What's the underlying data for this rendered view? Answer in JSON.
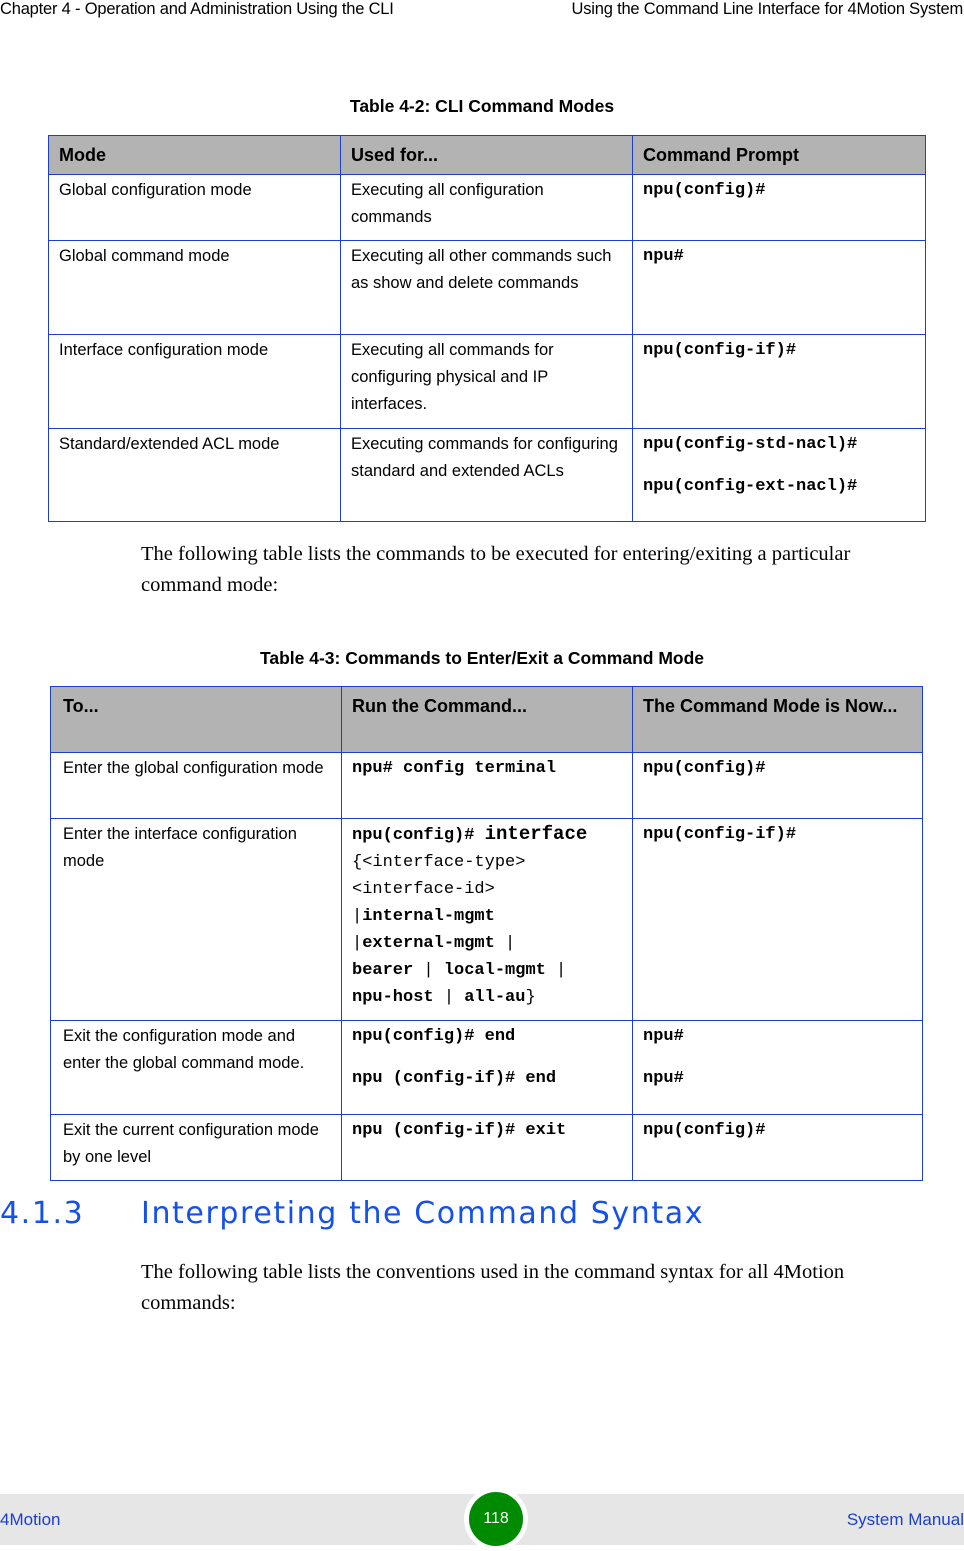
{
  "header": {
    "chapter": "Chapter 4 - Operation and Administration Using the CLI",
    "section": "Using the Command Line Interface for 4Motion System"
  },
  "table_modes": {
    "caption": "Table 4-2: CLI Command Modes",
    "columns": [
      "Mode",
      "Used for...",
      "Command Prompt"
    ],
    "rows": [
      {
        "mode": "Global configuration mode",
        "used_for": "Executing all configuration commands",
        "prompts": [
          "npu(config)#"
        ]
      },
      {
        "mode": "Global command mode",
        "used_for": "Executing all other commands such as show and delete commands",
        "prompts": [
          "npu#"
        ]
      },
      {
        "mode": "Interface configuration mode",
        "used_for": "Executing all commands for configuring physical and IP interfaces.",
        "prompts": [
          "npu(config-if)#"
        ]
      },
      {
        "mode": "Standard/extended ACL mode",
        "used_for": "Executing commands for configuring standard and extended ACLs",
        "prompts": [
          "npu(config-std-nacl)#",
          "npu(config-ext-nacl)#"
        ]
      }
    ]
  },
  "paragraph_1": "The following table lists the commands to be executed for entering/exiting a particular command mode:",
  "table_enter_exit": {
    "caption": "Table 4-3: Commands to Enter/Exit a Command Mode",
    "columns": [
      "To...",
      "Run the Command...",
      "The Command Mode is Now..."
    ],
    "rows": [
      {
        "to": "Enter the global configuration mode",
        "commands": [
          "npu# config terminal"
        ],
        "result_modes": [
          "npu(config)#"
        ]
      },
      {
        "to": "Enter the interface configuration mode",
        "command_lines": [
          "npu(config)# interface",
          "{<interface-type>",
          "<interface-id>",
          "|internal-mgmt",
          "|external-mgmt |",
          "bearer | local-mgmt |",
          "npu-host | all-au}"
        ],
        "result_modes": [
          "npu(config-if)#"
        ]
      },
      {
        "to": "Exit the configuration mode and enter the global command mode.",
        "commands": [
          "npu(config)# end",
          "npu (config-if)# end"
        ],
        "result_modes": [
          "npu#",
          "npu#"
        ]
      },
      {
        "to": "Exit the current configuration mode by one level",
        "commands": [
          "npu (config-if)# exit"
        ],
        "result_modes": [
          "npu(config)#"
        ]
      }
    ]
  },
  "section": {
    "number": "4.1.3",
    "title": "Interpreting the Command Syntax"
  },
  "paragraph_2": "The following table lists the conventions used in the command syntax for all 4Motion commands:",
  "footer": {
    "product": "4Motion",
    "page_number": "118",
    "doc_title": "System Manual"
  },
  "colors": {
    "table_border": "#1a3fcc",
    "table_header_bg": "#b3b3b3",
    "heading_blue": "#1550e8",
    "footer_bg": "#e6e6e6",
    "page_badge": "#008a00"
  }
}
